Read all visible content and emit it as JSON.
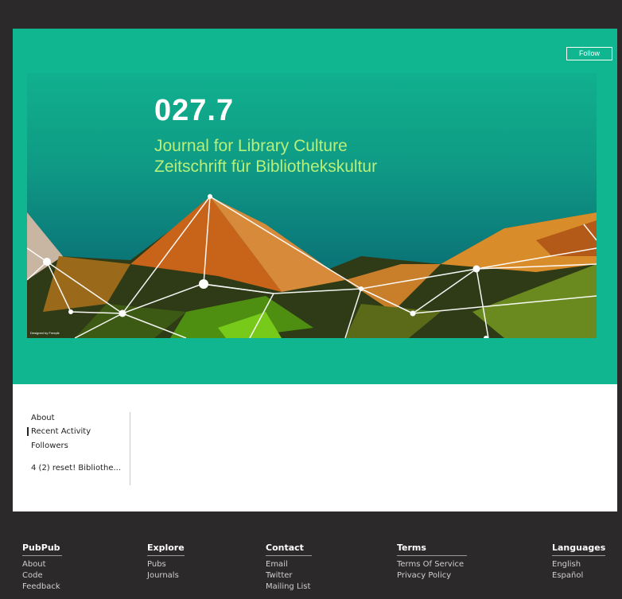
{
  "hero": {
    "follow_label": "Follow",
    "banner": {
      "title": "027.7",
      "subtitle_en": "Journal for Library Culture",
      "subtitle_de": "Zeitschrift für Bibliothekskultur",
      "credit": "Designed by Freepik"
    }
  },
  "nav": {
    "items": [
      {
        "label": "About"
      },
      {
        "label": "Recent Activity",
        "active": true
      },
      {
        "label": "Followers"
      },
      {
        "label": "4 (2) reset! Bibliothe..."
      }
    ]
  },
  "footer": {
    "columns": [
      {
        "heading": "PubPub",
        "links": [
          "About",
          "Code",
          "Feedback"
        ]
      },
      {
        "heading": "Explore",
        "links": [
          "Pubs",
          "Journals"
        ]
      },
      {
        "heading": "Contact",
        "links": [
          "Email",
          "Twitter",
          "Mailing List"
        ]
      },
      {
        "heading": "Terms",
        "links": [
          "Terms Of Service",
          "Privacy Policy"
        ]
      },
      {
        "heading": "Languages",
        "links": [
          "English",
          "Español"
        ]
      }
    ]
  },
  "colors": {
    "teal": "#10b68f",
    "dark": "#2b2929",
    "accent_green": "#b6ef7a"
  }
}
